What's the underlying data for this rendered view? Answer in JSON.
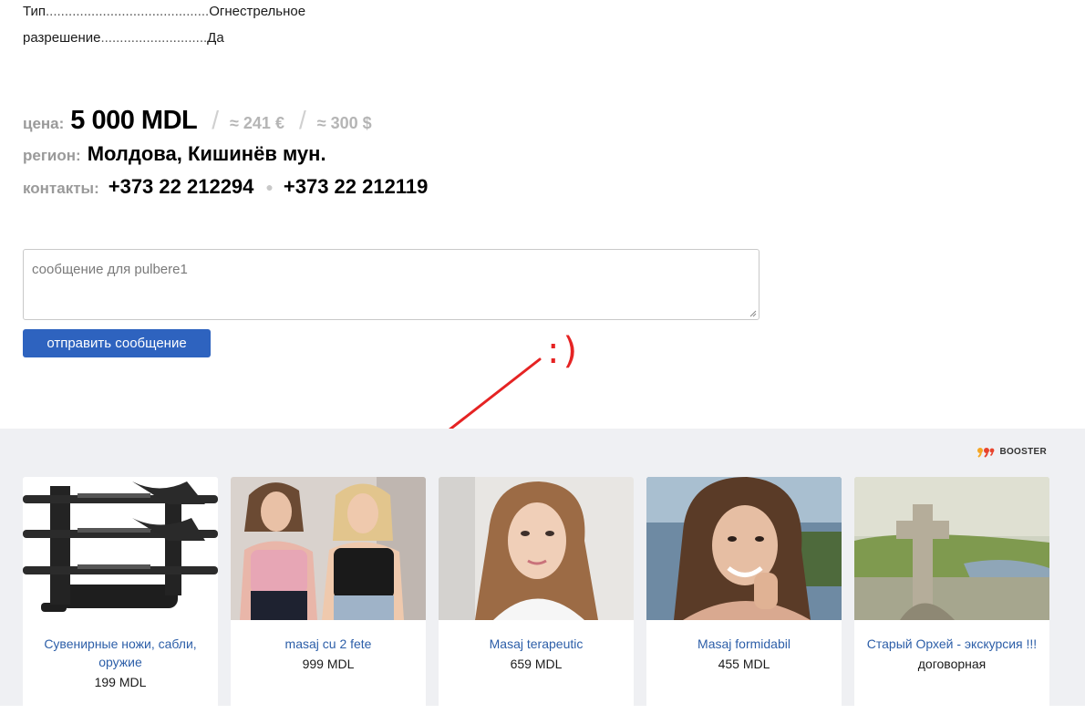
{
  "features": [
    {
      "key": "Тип",
      "dots": "...........................................",
      "value": "Огнестрельное"
    },
    {
      "key": "разрешение",
      "dots": "............................",
      "value": "Да"
    }
  ],
  "price": {
    "label": "цена:",
    "main": "5 000 MDL",
    "slash": "/",
    "eur": "≈ 241 €",
    "usd": "≈ 300 $"
  },
  "region": {
    "label": "регион:",
    "value": "Молдова, Кишинёв мун."
  },
  "contacts": {
    "label": "контакты:",
    "phone1": "+373 22 212294",
    "separator": "●",
    "phone2": "+373 22 212119"
  },
  "message": {
    "placeholder": "сообщение для pulbere1",
    "send_label": "отправить сообщение"
  },
  "annotation": {
    "smiley": ":)",
    "color": "#e52323"
  },
  "booster": {
    "label": "BOOSTER"
  },
  "cards": [
    {
      "title": "Сувенирные ножи, сабли, оружие",
      "price": "199 MDL",
      "image": "katana-stand-photo"
    },
    {
      "title": "masaj cu 2 fete",
      "price": "999 MDL",
      "image": "two-women-photo"
    },
    {
      "title": "Masaj terapeutic",
      "price": "659 MDL",
      "image": "woman-portrait-photo"
    },
    {
      "title": "Masaj formidabil",
      "price": "455 MDL",
      "image": "smiling-woman-photo"
    },
    {
      "title": "Старый Орхей - экскурсия !!!",
      "price": "договорная",
      "image": "stone-cross-landscape-photo"
    }
  ],
  "colors": {
    "accent": "#2e63bf",
    "link": "#2c5ea8",
    "muted": "#9a9a9a",
    "booster_bg": "#eff0f3"
  }
}
